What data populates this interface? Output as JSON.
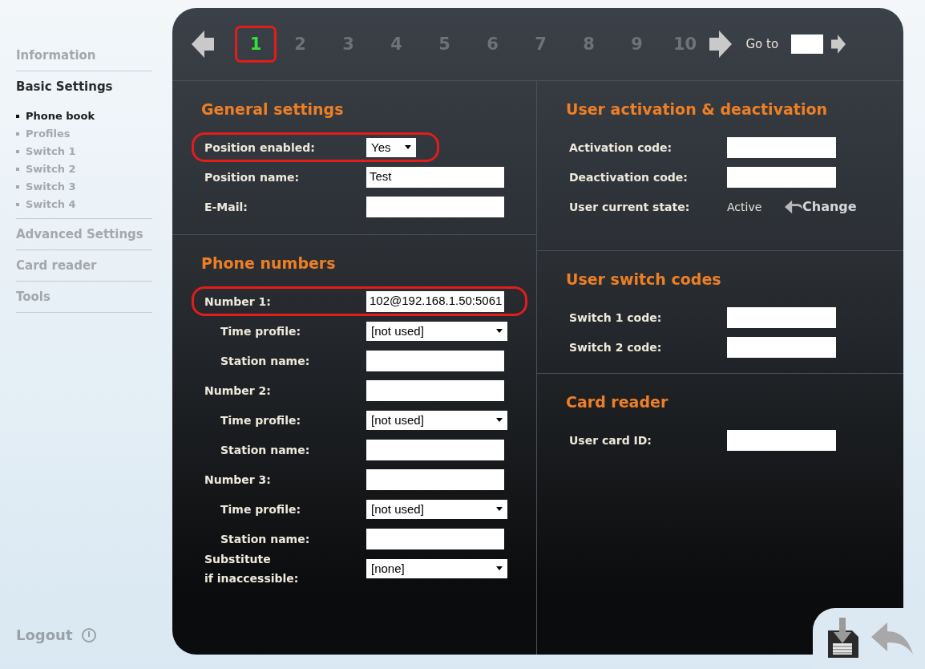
{
  "sidebar": {
    "items": [
      {
        "label": "Information",
        "selected": false
      },
      {
        "label": "Basic Settings",
        "selected": true,
        "children": [
          {
            "label": "Phone book",
            "selected": true
          },
          {
            "label": "Profiles",
            "selected": false
          },
          {
            "label": "Switch 1",
            "selected": false
          },
          {
            "label": "Switch 2",
            "selected": false
          },
          {
            "label": "Switch 3",
            "selected": false
          },
          {
            "label": "Switch 4",
            "selected": false
          }
        ]
      },
      {
        "label": "Advanced Settings",
        "selected": false
      },
      {
        "label": "Card reader",
        "selected": false
      },
      {
        "label": "Tools",
        "selected": false
      }
    ],
    "logout": "Logout"
  },
  "pager": {
    "pages": [
      {
        "label": "1",
        "selected": true,
        "highlighted": true
      },
      {
        "label": "2",
        "selected": false,
        "highlighted": false
      },
      {
        "label": "3",
        "selected": false,
        "highlighted": false
      },
      {
        "label": "4",
        "selected": false,
        "highlighted": false
      },
      {
        "label": "5",
        "selected": false,
        "highlighted": false
      },
      {
        "label": "6",
        "selected": false,
        "highlighted": false
      },
      {
        "label": "7",
        "selected": false,
        "highlighted": false
      },
      {
        "label": "8",
        "selected": false,
        "highlighted": false
      },
      {
        "label": "9",
        "selected": false,
        "highlighted": false
      },
      {
        "label": "10",
        "selected": false,
        "highlighted": false
      }
    ],
    "goto_label": "Go to"
  },
  "left_sections": [
    {
      "title": "General settings",
      "fields": [
        {
          "label": "Position enabled:",
          "kind": "select",
          "value": "Yes",
          "highlighted": true
        },
        {
          "label": "Position name:",
          "kind": "input",
          "value": "Test",
          "highlighted": false
        },
        {
          "label": "E-Mail:",
          "kind": "input",
          "highlighted": false
        }
      ]
    },
    {
      "title": "Phone numbers",
      "fields": [
        {
          "label": "Number 1:",
          "kind": "input",
          "value": "102@192.168.1.50:5061",
          "highlighted": true,
          "children": [
            {
              "label": "Time profile:",
              "kind": "select",
              "value": "[not used]",
              "highlighted": false
            },
            {
              "label": "Station name:",
              "kind": "input",
              "highlighted": false
            }
          ]
        },
        {
          "label": "Number 2:",
          "kind": "input",
          "highlighted": false,
          "children": [
            {
              "label": "Time profile:",
              "kind": "select",
              "value": "[not used]",
              "highlighted": false
            },
            {
              "label": "Station name:",
              "kind": "input",
              "highlighted": false
            }
          ]
        },
        {
          "label": "Number 3:",
          "kind": "input",
          "highlighted": false,
          "children": [
            {
              "label": "Time profile:",
              "kind": "select",
              "value": "[not used]",
              "highlighted": false
            },
            {
              "label": "Station name:",
              "kind": "input",
              "highlighted": false
            }
          ]
        },
        {
          "label": "Substitute\nif inaccessible:",
          "kind": "select",
          "value": "[none]",
          "highlighted": false
        }
      ]
    }
  ],
  "right_sections": [
    {
      "title": "User activation & deactivation",
      "fields": [
        {
          "label": "Activation code:",
          "kind": "input"
        },
        {
          "label": "Deactivation code:",
          "kind": "input"
        },
        {
          "label": "User current state:",
          "kind": "status",
          "value": "Active",
          "action": "Change"
        }
      ]
    },
    {
      "title": "User switch codes",
      "fields": [
        {
          "label": "Switch 1 code:",
          "kind": "input"
        },
        {
          "label": "Switch 2 code:",
          "kind": "input"
        }
      ]
    },
    {
      "title": "Card reader",
      "fields": [
        {
          "label": "User card ID:",
          "kind": "input"
        }
      ]
    }
  ]
}
